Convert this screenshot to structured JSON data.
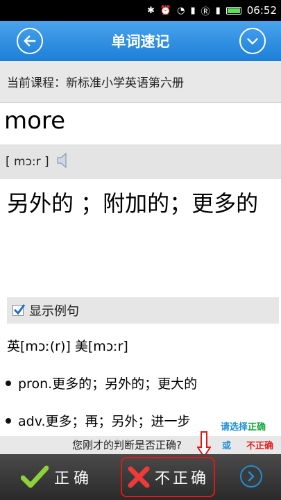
{
  "status_bar": {
    "time": "06:52"
  },
  "header": {
    "title": "单词速记"
  },
  "course": {
    "label": "当前课程：新标准小学英语第六册"
  },
  "word": {
    "text": "more",
    "phonetic": "[ mɔ:r ]"
  },
  "meaning": {
    "text": "另外的 ；附加的；更多的"
  },
  "example": {
    "label": "显示例句",
    "checked": true
  },
  "pronunciation": {
    "text": "英[mɔː(r)] 美[mɔːr]"
  },
  "definitions": [
    "pron.更多的；另外的；更大的",
    "adv.更多；再；另外；进一步"
  ],
  "prompt": {
    "question": "您刚才的判断是否正确?",
    "hint_select": "请选择",
    "hint_correct": "正确",
    "hint_or": "或",
    "hint_wrong": "不正确"
  },
  "actions": {
    "correct_label": "正确",
    "wrong_label": "不正确"
  },
  "colors": {
    "header_blue": "#1c7fd6",
    "accent_blue": "#1f8fd8",
    "green": "#1aa63a",
    "red": "#e02020"
  }
}
